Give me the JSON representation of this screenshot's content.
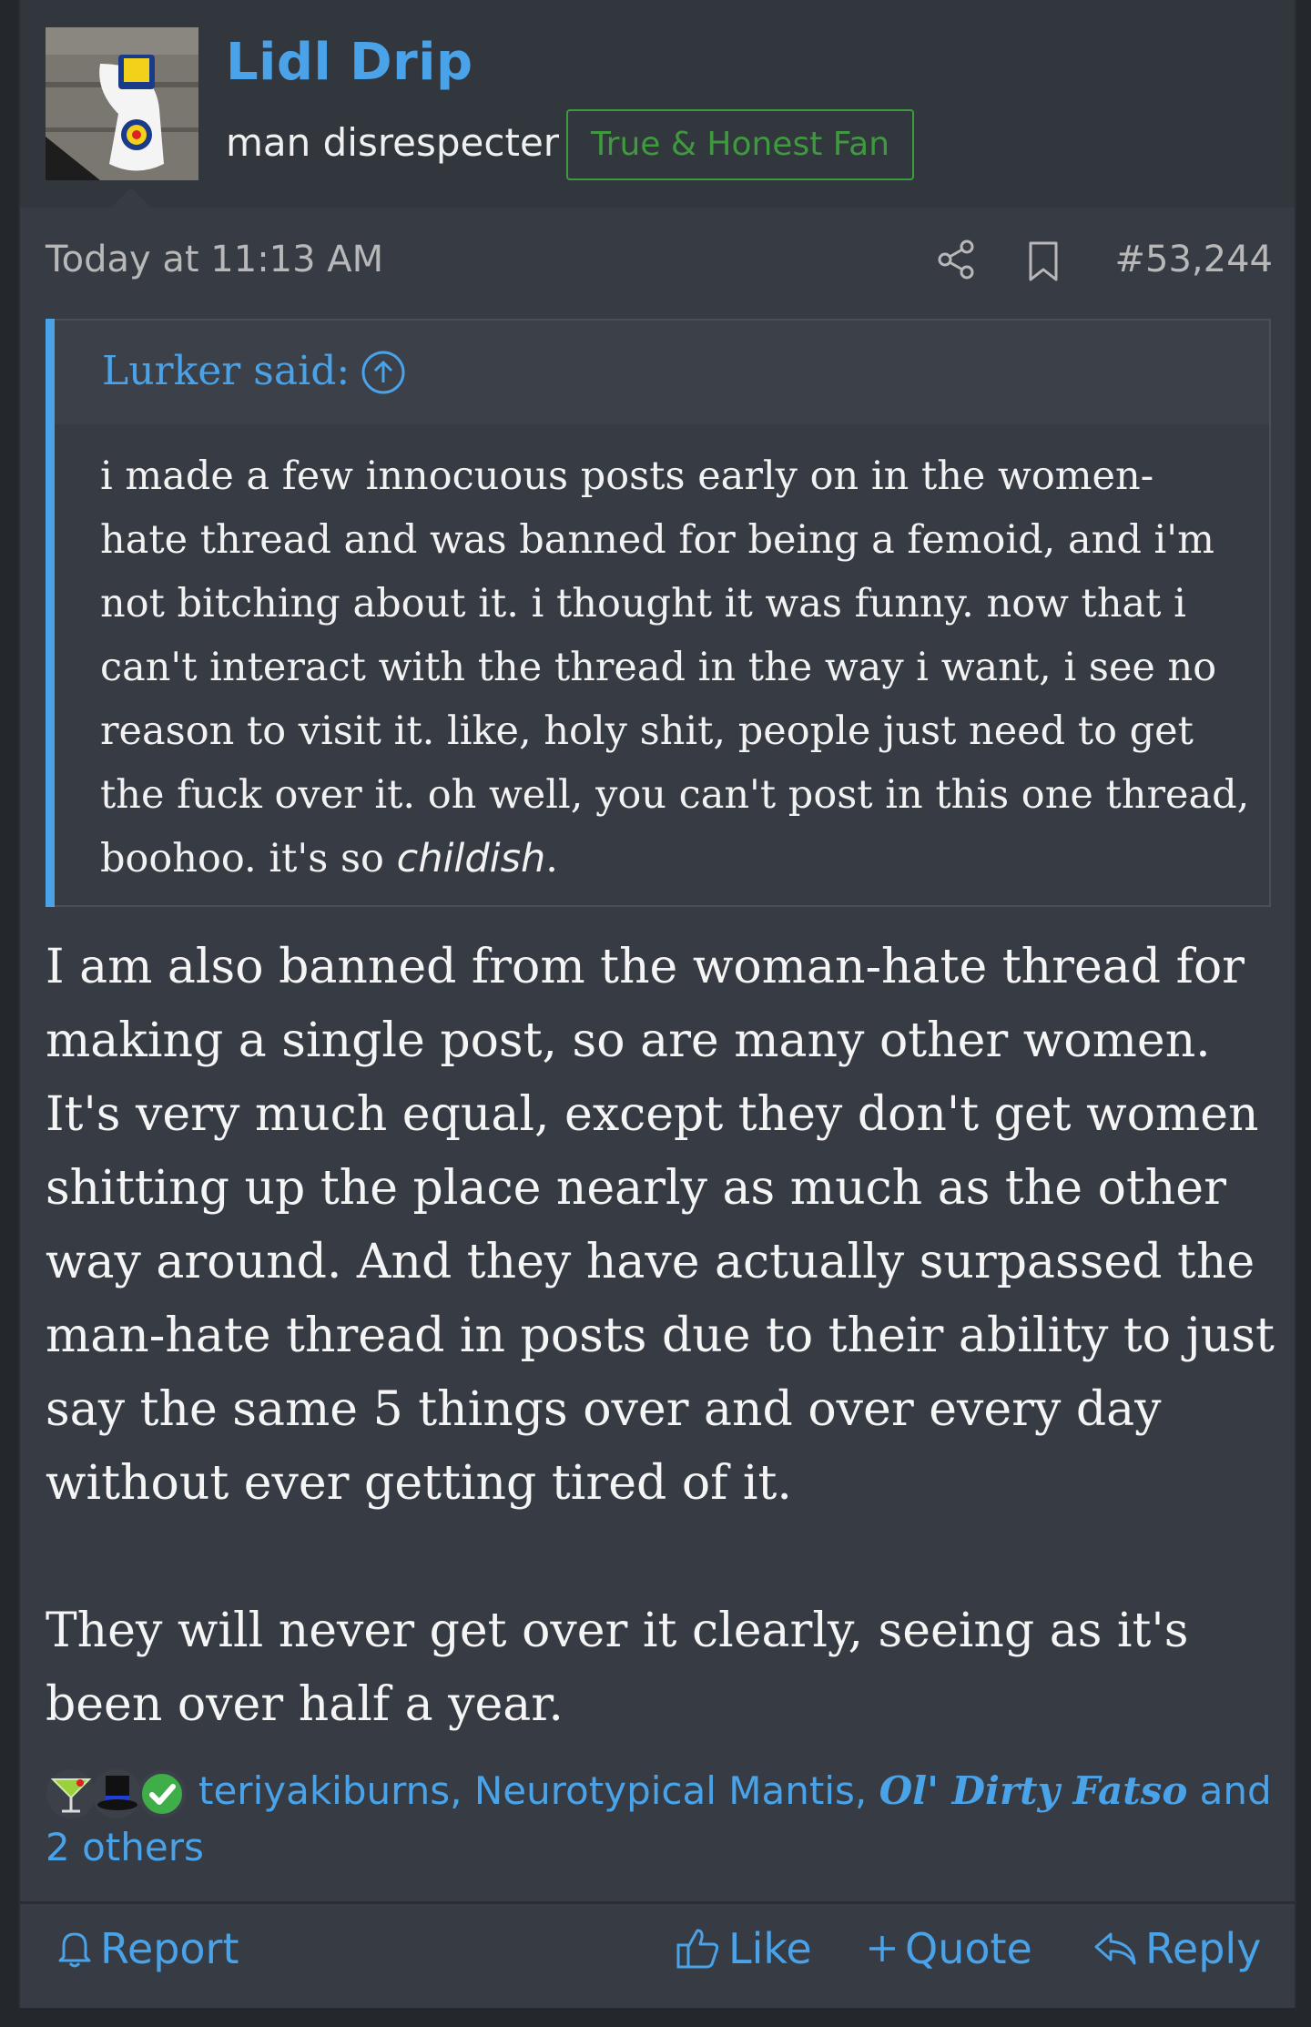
{
  "user": {
    "name": "Lidl Drip",
    "title": "man disrespecter",
    "banner": "True & Honest Fan"
  },
  "meta": {
    "time": "Today at 11:13 AM",
    "post_number": "#53,244",
    "icons": [
      "share-icon",
      "bookmark-icon"
    ]
  },
  "quote": {
    "author": "Lurker said:",
    "lines": [
      "i made a few innocuous posts early on in the women-",
      "hate thread and was banned for being a femoid, and i'm",
      "not bitching about it. i thought it was funny. now that i",
      "can't interact with the thread in the way i want, i see no",
      "reason to visit it. like, holy shit, people just need to get",
      "the fuck over it. oh well, you can't post in this one thread,"
    ],
    "last_line_prefix": "boohoo. it's so ",
    "last_line_emphasis": "childish",
    "last_line_suffix": "."
  },
  "body": {
    "paragraph1": "I am also banned from the woman-hate thread for making a single post, so are many other women. It's very much equal, except they don't get women shitting up the place nearly as much as the other way around. And they have actually surpassed the man-hate thread in posts due to their ability to just say the same 5 things over and over every day without ever getting tired of it.",
    "paragraph2": "They will never get over it clearly, seeing as it's been over half a year."
  },
  "reactions": {
    "names_part1": "teriyakiburns, Neurotypical Mantis, ",
    "names_fancy": "Ol' Dirty Fatso",
    "names_part2": " and 2 others",
    "icons": [
      "cocktail-icon",
      "top-hat-icon",
      "check-icon"
    ]
  },
  "actions": {
    "report": "Report",
    "like": "Like",
    "quote": "Quote",
    "reply": "Reply"
  },
  "colors": {
    "accent": "#4aa3e8",
    "banner": "#3f9a3f",
    "background": "#373b43"
  }
}
